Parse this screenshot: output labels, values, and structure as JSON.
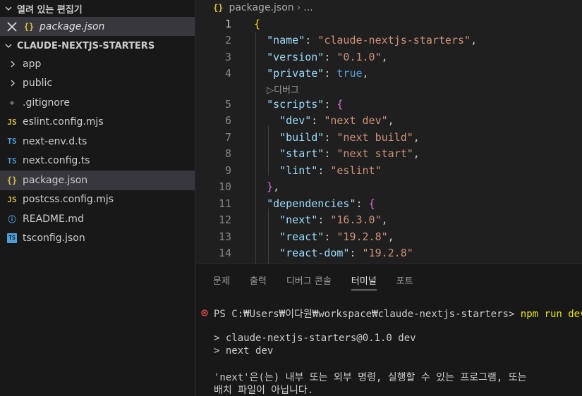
{
  "sidebar": {
    "open_editors_title": "열려 있는 편집기",
    "open_editor_file": "package.json",
    "project_title": "CLAUDE-NEXTJS-STARTERS",
    "items": [
      {
        "label": "app",
        "type": "folder"
      },
      {
        "label": "public",
        "type": "folder"
      },
      {
        "label": ".gitignore",
        "type": "git"
      },
      {
        "label": "eslint.config.mjs",
        "type": "js"
      },
      {
        "label": "next-env.d.ts",
        "type": "ts"
      },
      {
        "label": "next.config.ts",
        "type": "ts"
      },
      {
        "label": "package.json",
        "type": "json"
      },
      {
        "label": "postcss.config.mjs",
        "type": "js"
      },
      {
        "label": "README.md",
        "type": "info"
      },
      {
        "label": "tsconfig.json",
        "type": "tsconfig"
      }
    ],
    "icon_glyphs": {
      "json": "{}",
      "js": "JS",
      "ts": "TS",
      "git": "◆",
      "info": "ⓘ",
      "tsconfig": "TS"
    }
  },
  "editor": {
    "breadcrumb_file": "package.json",
    "breadcrumb_more": "...",
    "codelens": "▷디버그",
    "line_numbers": [
      "1",
      "2",
      "3",
      "4",
      "5",
      "6",
      "7",
      "8",
      "9",
      "10",
      "11",
      "12",
      "13",
      "14"
    ]
  },
  "panel": {
    "tabs": [
      "문제",
      "출력",
      "디버그 콘솔",
      "터미널",
      "포트"
    ],
    "active_tab": "터미널",
    "terminal": {
      "prompt": "PS C:₩Users₩이다원₩workspace₩claude-nextjs-starters> ",
      "command": "npm run dev",
      "out1": "> claude-nextjs-starters@0.1.0 dev",
      "out2": "> next dev",
      "err1": "'next'은(는) 내부 또는 외부 명령, 실행할 수 있는 프로그램, 또는",
      "err2": "배치 파일이 아닙니다."
    }
  },
  "colors": {
    "error": "#f14c4c",
    "command": "#e5e510",
    "json_icon": "#d7ba46",
    "ts_icon": "#4f9dd6"
  }
}
